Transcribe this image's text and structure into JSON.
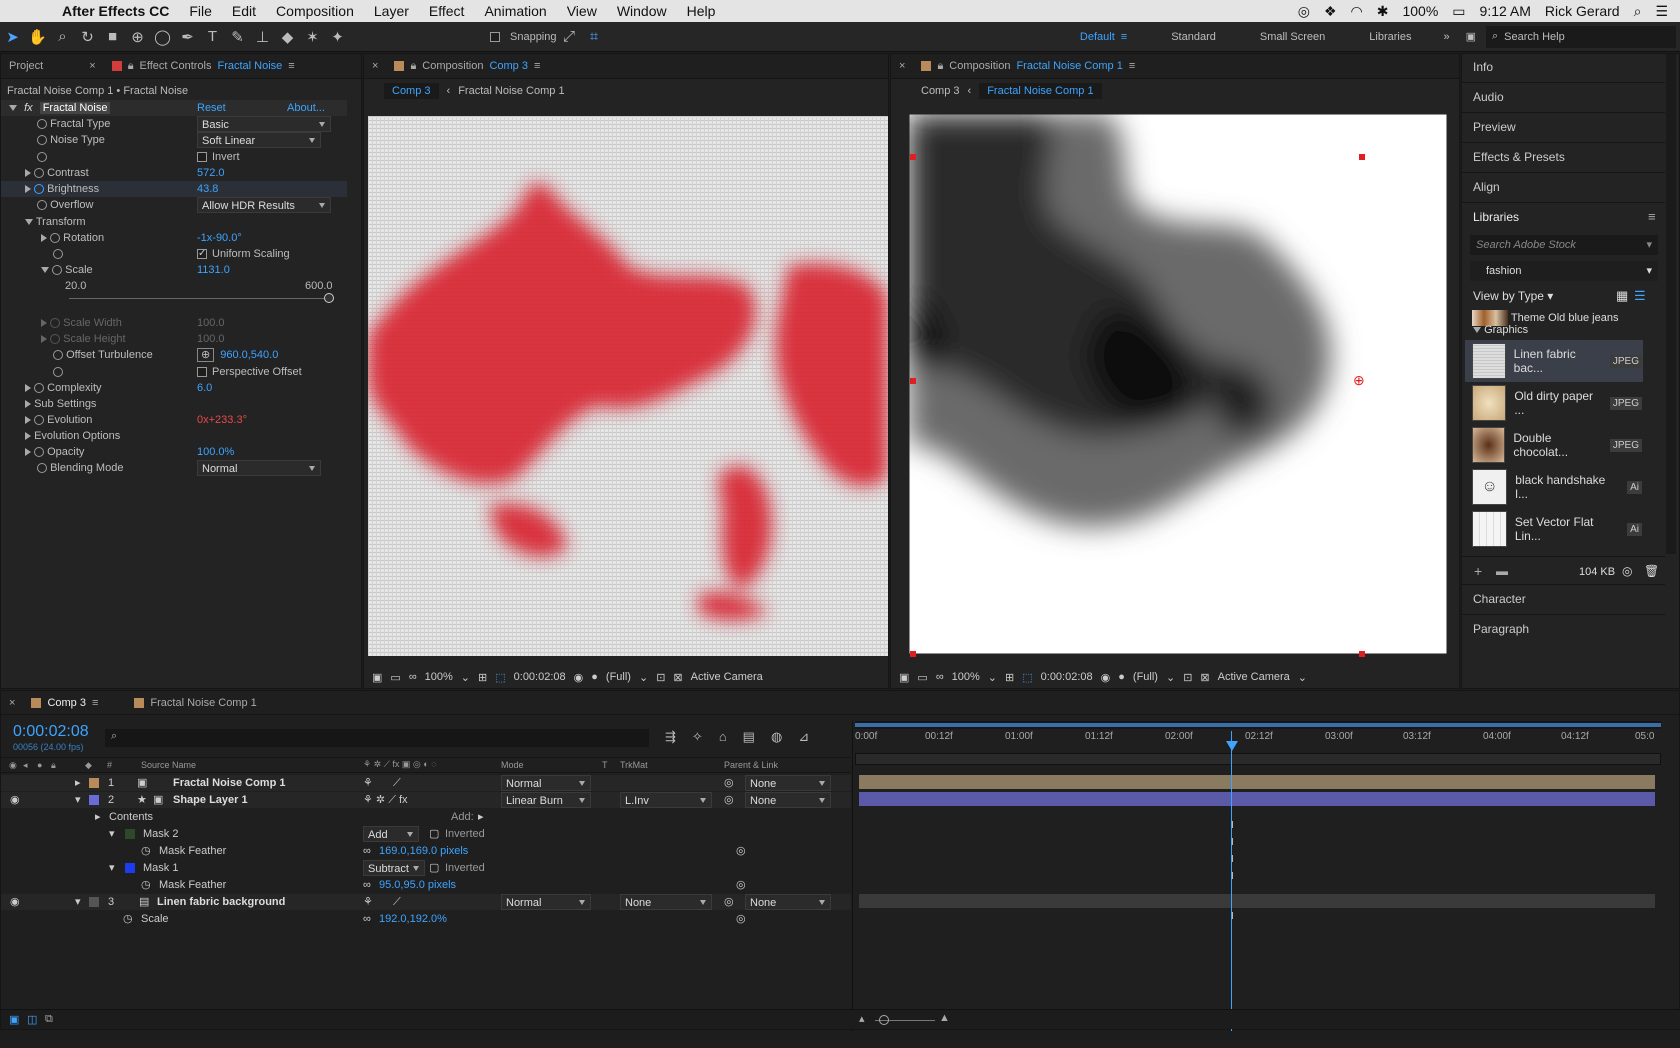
{
  "menubar": {
    "app": "After Effects CC",
    "items": [
      "File",
      "Edit",
      "Composition",
      "Layer",
      "Effect",
      "Animation",
      "View",
      "Window",
      "Help"
    ],
    "battery": "100%",
    "time": "9:12 AM",
    "user": "Rick Gerard"
  },
  "toolbar": {
    "snapping": "Snapping",
    "workspaces": [
      "Default",
      "Standard",
      "Small Screen",
      "Libraries"
    ],
    "search_help": "Search Help"
  },
  "effect_controls": {
    "tab_project": "Project",
    "tab_label": "Effect Controls",
    "tab_target": "Fractal Noise",
    "breadcrumb": "Fractal Noise Comp 1 • Fractal Noise",
    "effect_name": "Fractal Noise",
    "reset": "Reset",
    "about": "About...",
    "fractal_type_label": "Fractal Type",
    "fractal_type_value": "Basic",
    "noise_type_label": "Noise Type",
    "noise_type_value": "Soft Linear",
    "invert": "Invert",
    "contrast_label": "Contrast",
    "contrast_value": "572.0",
    "brightness_label": "Brightness",
    "brightness_value": "43.8",
    "overflow_label": "Overflow",
    "overflow_value": "Allow HDR Results",
    "transform_label": "Transform",
    "rotation_label": "Rotation",
    "rotation_value": "-1x-90.0°",
    "uniform_scaling": "Uniform Scaling",
    "scale_label": "Scale",
    "scale_value": "1131.0",
    "scale_min": "20.0",
    "scale_max": "600.0",
    "scale_width_label": "Scale Width",
    "scale_width_value": "100.0",
    "scale_height_label": "Scale Height",
    "scale_height_value": "100.0",
    "offset_label": "Offset Turbulence",
    "offset_value": "960.0,540.0",
    "perspective_offset": "Perspective Offset",
    "complexity_label": "Complexity",
    "complexity_value": "6.0",
    "sub_settings_label": "Sub Settings",
    "evolution_label": "Evolution",
    "evolution_value": "0x+233.3°",
    "evolution_options_label": "Evolution Options",
    "opacity_label": "Opacity",
    "opacity_value": "100.0%",
    "blending_label": "Blending Mode",
    "blending_value": "Normal"
  },
  "viewer_left": {
    "tab_label": "Composition",
    "tab_target": "Comp 3",
    "crumb_active": "Comp 3",
    "crumb_other": "Fractal Noise Comp 1",
    "zoom": "100%",
    "timecode": "0:00:02:08",
    "resolution": "(Full)",
    "camera": "Active Camera"
  },
  "viewer_right": {
    "tab_label": "Composition",
    "tab_target": "Fractal Noise Comp 1",
    "crumb_other": "Comp 3",
    "crumb_active": "Fractal Noise Comp 1",
    "zoom": "100%",
    "timecode": "0:00:02:08",
    "resolution": "(Full)",
    "camera": "Active Camera"
  },
  "right_panel": {
    "info": "Info",
    "audio": "Audio",
    "preview": "Preview",
    "effects_presets": "Effects & Presets",
    "align": "Align",
    "libraries": "Libraries",
    "search_stock": "Search Adobe Stock",
    "library_name": "fashion",
    "view_by": "View by Type",
    "theme_item": "Theme Old blue jeans",
    "graphics": "Graphics",
    "items": [
      {
        "name": "Linen fabric bac...",
        "kind": "JPEG"
      },
      {
        "name": "Old dirty paper ...",
        "kind": "JPEG"
      },
      {
        "name": "Double chocolat...",
        "kind": "JPEG"
      },
      {
        "name": "black handshake l...",
        "kind": "Ai"
      },
      {
        "name": "Set Vector Flat Lin...",
        "kind": "Ai"
      }
    ],
    "size": "104 KB",
    "character": "Character",
    "paragraph": "Paragraph"
  },
  "timeline": {
    "tab_active": "Comp 3",
    "tab_other": "Fractal Noise Comp 1",
    "timecode": "0:00:02:08",
    "frames": "00056 (24.00 fps)",
    "col_source": "Source Name",
    "col_mode": "Mode",
    "col_t": "T",
    "col_trkmat": "TrkMat",
    "col_parent": "Parent & Link",
    "ruler": [
      "0:00f",
      "00:12f",
      "01:00f",
      "01:12f",
      "02:00f",
      "02:12f",
      "03:00f",
      "03:12f",
      "04:00f",
      "04:12f",
      "05:0"
    ],
    "layer1": {
      "num": "1",
      "name": "Fractal Noise Comp 1",
      "mode": "Normal",
      "parent": "None"
    },
    "layer2": {
      "num": "2",
      "name": "Shape Layer 1",
      "mode": "Linear Burn",
      "trkmat": "L.Inv",
      "parent": "None"
    },
    "contents": "Contents",
    "add": "Add:",
    "mask2": "Mask 2",
    "mask2_mode": "Add",
    "inverted": "Inverted",
    "mask_feather": "Mask Feather",
    "mask2_feather": "169.0,169.0 pixels",
    "mask1": "Mask 1",
    "mask1_mode": "Subtract",
    "mask1_feather": "95.0,95.0 pixels",
    "layer3": {
      "num": "3",
      "name": "Linen fabric background",
      "mode": "Normal",
      "trkmat": "None",
      "parent": "None"
    },
    "scale_label": "Scale",
    "scale_value": "192.0,192.0%"
  }
}
